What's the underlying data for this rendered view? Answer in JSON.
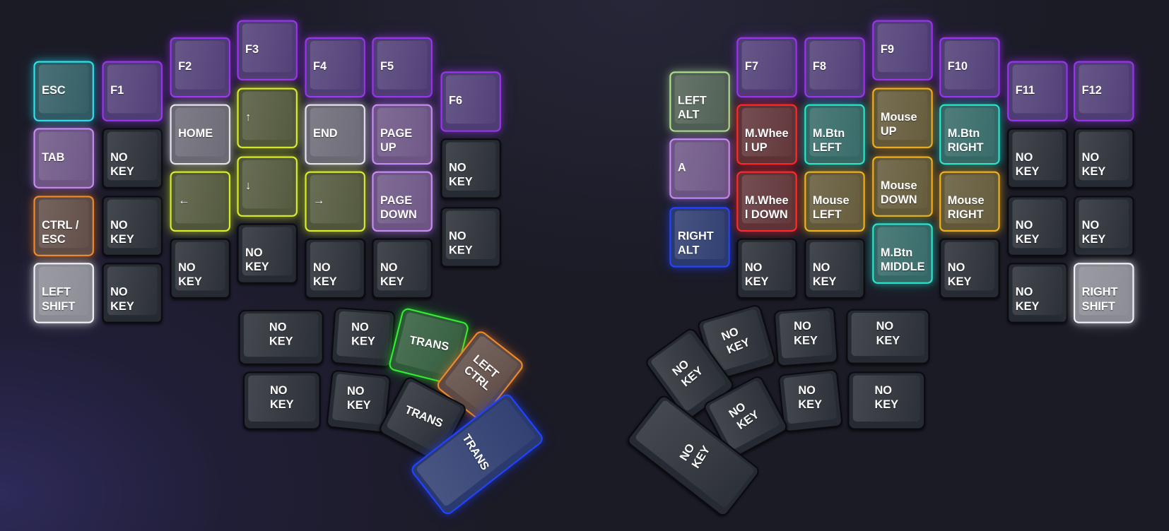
{
  "themes": {
    "none": {
      "border": "#0b0b0f",
      "bg": "#262a32",
      "glow": ""
    },
    "cyan": {
      "border": "#2ee6f0",
      "bg": "#2f5a62",
      "glow": "#22d3ee"
    },
    "purple": {
      "border": "#9b34f0",
      "bg": "#4e3c74",
      "glow": "#9333ea"
    },
    "lavender": {
      "border": "#c98cf5",
      "bg": "#6c5484",
      "glow": "#c084fc"
    },
    "white": {
      "border": "#e8e4f0",
      "bg": "#6a6874",
      "glow": "#ffffff"
    },
    "silver": {
      "border": "#f4f4f8",
      "bg": "#8a8a94",
      "glow": "#ffffff"
    },
    "yellow": {
      "border": "#dcef2a",
      "bg": "#50563a",
      "glow": "#d9f02a"
    },
    "orange": {
      "border": "#f08a2a",
      "bg": "#5e4a44",
      "glow": "#ea7a2a"
    },
    "green": {
      "border": "#b0e090",
      "bg": "#4e5e52",
      "glow": "#a8d88a"
    },
    "blue": {
      "border": "#2244ff",
      "bg": "#2b3a6e",
      "glow": "#1f3fff"
    },
    "red": {
      "border": "#ff2a2a",
      "bg": "#5e3236",
      "glow": "#ff2020"
    },
    "teal": {
      "border": "#28e8d0",
      "bg": "#336866",
      "glow": "#20e0c8"
    },
    "amber": {
      "border": "#f2b21c",
      "bg": "#625838",
      "glow": "#f0b020"
    },
    "lime": {
      "border": "#33ee33",
      "bg": "#2f5a3a",
      "glow": "#22ee22"
    }
  },
  "left": {
    "keys": [
      {
        "label": "ESC",
        "theme": "cyan"
      },
      {
        "label": "TAB",
        "theme": "lavender"
      },
      {
        "label": "CTRL /\nESC",
        "theme": "orange"
      },
      {
        "label": "LEFT\nSHIFT",
        "theme": "silver"
      },
      {
        "label": "F1",
        "theme": "purple"
      },
      {
        "label": "NO\nKEY",
        "theme": "none"
      },
      {
        "label": "NO\nKEY",
        "theme": "none"
      },
      {
        "label": "NO\nKEY",
        "theme": "none"
      },
      {
        "label": "F2",
        "theme": "purple"
      },
      {
        "label": "HOME",
        "theme": "white"
      },
      {
        "label": "←",
        "theme": "yellow"
      },
      {
        "label": "NO\nKEY",
        "theme": "none"
      },
      {
        "label": "F3",
        "theme": "purple"
      },
      {
        "label": "↑",
        "theme": "yellow"
      },
      {
        "label": "↓",
        "theme": "yellow"
      },
      {
        "label": "NO\nKEY",
        "theme": "none"
      },
      {
        "label": "F4",
        "theme": "purple"
      },
      {
        "label": "END",
        "theme": "white"
      },
      {
        "label": "→",
        "theme": "yellow"
      },
      {
        "label": "NO\nKEY",
        "theme": "none"
      },
      {
        "label": "F5",
        "theme": "purple"
      },
      {
        "label": "PAGE\nUP",
        "theme": "lavender"
      },
      {
        "label": "PAGE\nDOWN",
        "theme": "lavender"
      },
      {
        "label": "NO\nKEY",
        "theme": "none"
      },
      {
        "label": "F6",
        "theme": "purple"
      },
      {
        "label": "NO\nKEY",
        "theme": "none"
      },
      {
        "label": "NO\nKEY",
        "theme": "none"
      }
    ],
    "thumb": [
      {
        "label": "NO\nKEY",
        "theme": "none"
      },
      {
        "label": "NO\nKEY",
        "theme": "none"
      },
      {
        "label": "TRANS",
        "theme": "lime"
      },
      {
        "label": "LEFT\nCTRL",
        "theme": "orange"
      },
      {
        "label": "NO\nKEY",
        "theme": "none"
      },
      {
        "label": "NO\nKEY",
        "theme": "none"
      },
      {
        "label": "TRANS",
        "theme": "none"
      },
      {
        "label": "TRANS",
        "theme": "blue"
      }
    ]
  },
  "right": {
    "keys": [
      {
        "label": "LEFT\nALT",
        "theme": "green"
      },
      {
        "label": "A",
        "theme": "lavender"
      },
      {
        "label": "RIGHT\nALT",
        "theme": "blue"
      },
      {
        "label": "F7",
        "theme": "purple"
      },
      {
        "label": "M.Wheel UP",
        "theme": "red"
      },
      {
        "label": "M.Wheel DOWN",
        "theme": "red"
      },
      {
        "label": "NO\nKEY",
        "theme": "none"
      },
      {
        "label": "F8",
        "theme": "purple"
      },
      {
        "label": "M.Btn\nLEFT",
        "theme": "teal"
      },
      {
        "label": "Mouse\nLEFT",
        "theme": "amber"
      },
      {
        "label": "NO\nKEY",
        "theme": "none"
      },
      {
        "label": "F9",
        "theme": "purple"
      },
      {
        "label": "Mouse\nUP",
        "theme": "amber"
      },
      {
        "label": "Mouse\nDOWN",
        "theme": "amber"
      },
      {
        "label": "M.Btn\nMIDDLE",
        "theme": "teal"
      },
      {
        "label": "F10",
        "theme": "purple"
      },
      {
        "label": "M.Btn\nRIGHT",
        "theme": "teal"
      },
      {
        "label": "Mouse\nRIGHT",
        "theme": "amber"
      },
      {
        "label": "NO\nKEY",
        "theme": "none"
      },
      {
        "label": "F11",
        "theme": "purple"
      },
      {
        "label": "NO\nKEY",
        "theme": "none"
      },
      {
        "label": "NO\nKEY",
        "theme": "none"
      },
      {
        "label": "NO\nKEY",
        "theme": "none"
      },
      {
        "label": "F12",
        "theme": "purple"
      },
      {
        "label": "NO\nKEY",
        "theme": "none"
      },
      {
        "label": "NO\nKEY",
        "theme": "none"
      },
      {
        "label": "RIGHT\nSHIFT",
        "theme": "silver"
      }
    ],
    "thumb": [
      {
        "label": "NO\nKEY",
        "theme": "none"
      },
      {
        "label": "NO\nKEY",
        "theme": "none"
      },
      {
        "label": "NO\nKEY",
        "theme": "none"
      },
      {
        "label": "NO\nKEY",
        "theme": "none"
      },
      {
        "label": "NO\nKEY",
        "theme": "none"
      },
      {
        "label": "NO\nKEY",
        "theme": "none"
      },
      {
        "label": "NO\nKEY",
        "theme": "none"
      },
      {
        "label": "NO\nKEY",
        "theme": "none"
      }
    ]
  }
}
